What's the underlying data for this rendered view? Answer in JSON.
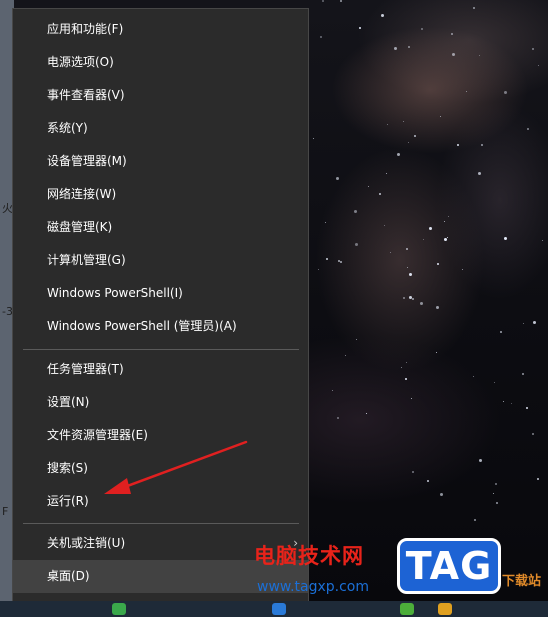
{
  "menu": {
    "items": [
      {
        "label": "应用和功能(F)"
      },
      {
        "label": "电源选项(O)"
      },
      {
        "label": "事件查看器(V)"
      },
      {
        "label": "系统(Y)"
      },
      {
        "label": "设备管理器(M)"
      },
      {
        "label": "网络连接(W)"
      },
      {
        "label": "磁盘管理(K)"
      },
      {
        "label": "计算机管理(G)"
      },
      {
        "label": "Windows PowerShell(I)"
      },
      {
        "label": "Windows PowerShell (管理员)(A)"
      },
      {
        "label": "任务管理器(T)"
      },
      {
        "label": "设置(N)"
      },
      {
        "label": "文件资源管理器(E)"
      },
      {
        "label": "搜索(S)"
      },
      {
        "label": "运行(R)"
      },
      {
        "label": "关机或注销(U)",
        "submenu_icon": "chevron-right-icon"
      },
      {
        "label": "桌面(D)"
      }
    ],
    "highlighted_item": "桌面(D)"
  },
  "annotation": {
    "arrow_color": "#e02020",
    "points_to": "运行(R)"
  },
  "watermark": {
    "title": "电脑技术网",
    "url": "www.tagxp.com",
    "logo_text": "TAG",
    "tail_text": "下载站",
    "title_color": "#e8231a",
    "logo_color": "#1d63d4"
  },
  "colors": {
    "menu_bg": "#2b2b2b",
    "menu_text": "#ffffff",
    "hover_bg": "#424242"
  }
}
